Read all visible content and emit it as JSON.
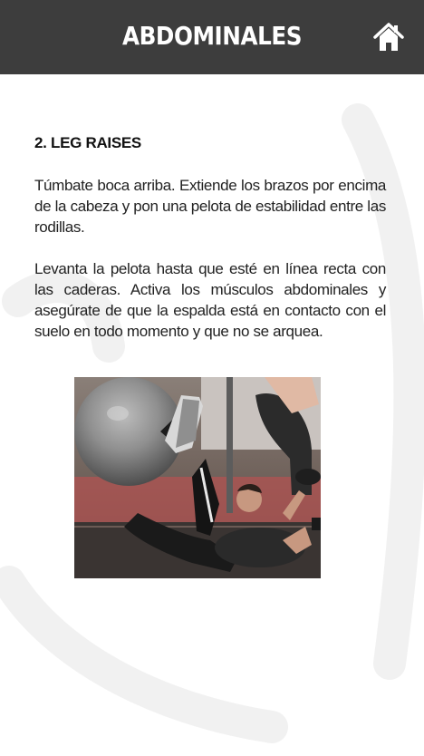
{
  "header": {
    "title": "ABDOMINALES",
    "home_icon": "home-icon",
    "background_color": "#3d3d3d"
  },
  "section": {
    "title": "2. LEG RAISES",
    "paragraphs": [
      "Túmbate boca arriba. Extiende los brazos por encima de la cabeza y pon una pelota de estabilidad entre las rodillas.",
      "Levanta la pelota hasta que esté en línea recta con las caderas. Activa los músculos abdominales y asegúrate de que la espalda está en contacto con el suelo en todo momento y que no se arquea."
    ]
  },
  "illustration": {
    "subject": "man-lying-raising-stability-ball-photo"
  }
}
